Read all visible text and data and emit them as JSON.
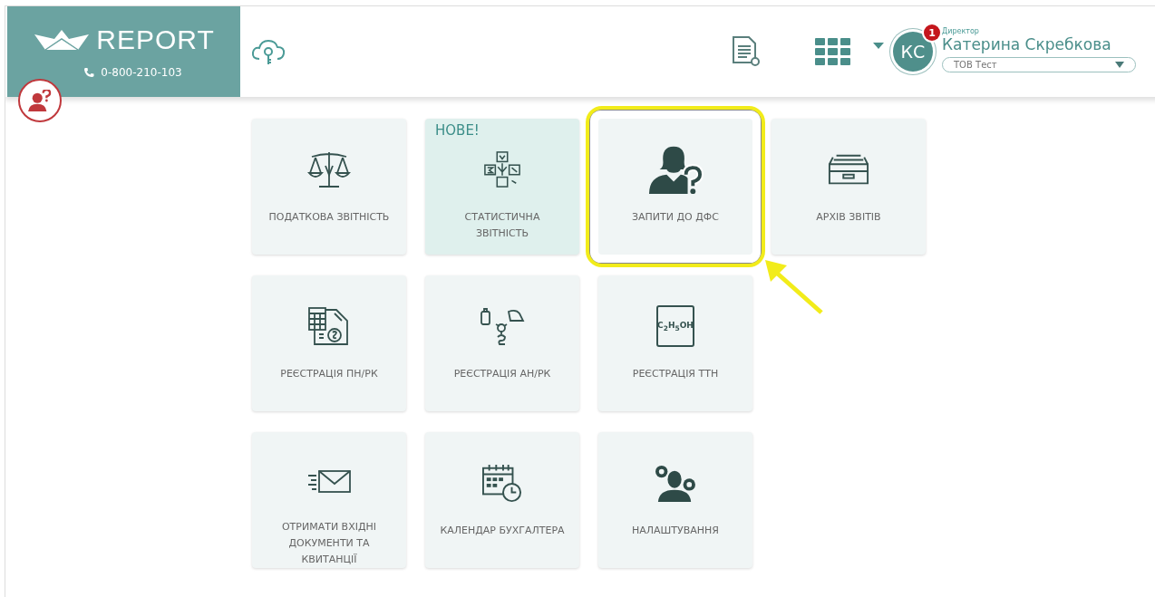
{
  "header": {
    "logo": "REPORT",
    "phone": "0-800-210-103",
    "user": {
      "initials": "КС",
      "notifications": "1",
      "role": "Директор",
      "name": "Катерина Скребкова",
      "company": "ТОВ Тест"
    }
  },
  "tiles": [
    {
      "label": "ПОДАТКОВА ЗВІТНІСТЬ",
      "highlighted": false
    },
    {
      "label": "СТАТИСТИЧНА ЗВІТНІСТЬ",
      "badge": "НОВЕ!",
      "highlighted": false
    },
    {
      "label": "ЗАПИТИ ДО ДФС",
      "highlighted": true
    },
    {
      "label": "АРХІВ ЗВІТІВ",
      "highlighted": false
    },
    {
      "label": "РЕЄСТРАЦІЯ ПН/РК",
      "highlighted": false
    },
    {
      "label": "РЕЄСТРАЦІЯ АН/РК",
      "highlighted": false
    },
    {
      "icon_text": "C$_{2}$H$_{5}$OH",
      "label": "РЕЄСТРАЦІЯ ТТН",
      "highlighted": false
    },
    {
      "label": "ОТРИМАТИ ВХІДНІ ДОКУМЕНТИ ТА КВИТАНЦІЇ",
      "highlighted": false
    },
    {
      "label": "КАЛЕНДАР БУХГАЛТЕРА",
      "highlighted": false
    },
    {
      "label": "НАЛАШТУВАННЯ",
      "highlighted": false
    }
  ]
}
